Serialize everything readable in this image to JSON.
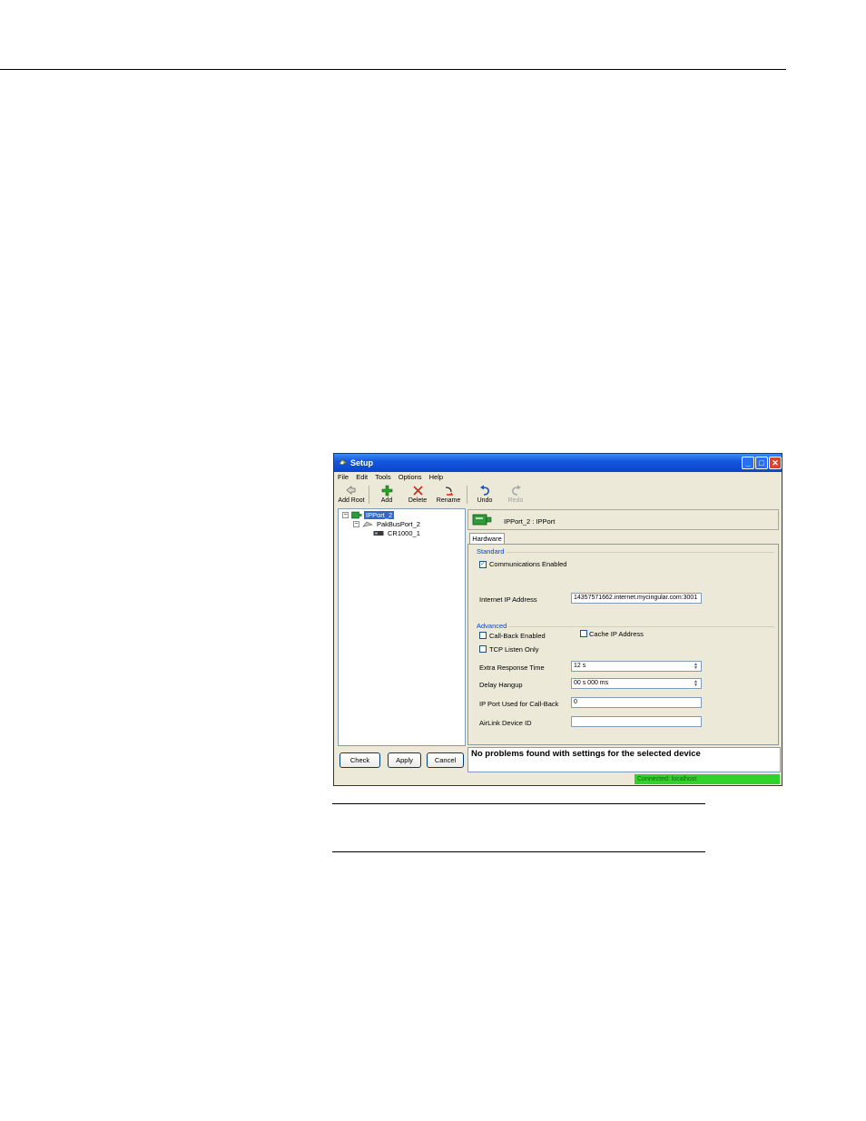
{
  "window": {
    "title": "Setup",
    "controls": {
      "minimize": "_",
      "maximize": "□",
      "close": "✕"
    }
  },
  "menu": [
    "File",
    "Edit",
    "Tools",
    "Options",
    "Help"
  ],
  "toolbar": {
    "add_root": "Add Root",
    "add": "Add",
    "delete": "Delete",
    "rename": "Rename",
    "undo": "Undo",
    "redo": "Redo"
  },
  "tree": {
    "nodes": [
      {
        "label": "IPPort_2",
        "expander": "−",
        "selected": true
      },
      {
        "label": "PakBusPort_2",
        "expander": "−"
      },
      {
        "label": "CR1000_1"
      }
    ]
  },
  "buttons": {
    "check": "Check",
    "apply": "Apply",
    "cancel": "Cancel"
  },
  "device_header": "IPPort_2 : IPPort",
  "tabs": [
    "Hardware"
  ],
  "standard": {
    "title": "Standard",
    "communications_enabled": {
      "label": "Communications Enabled",
      "checked": true,
      "mark": "✓"
    },
    "internet_ip_address": {
      "label": "Internet IP Address",
      "value": "14357571662.internet.mycingular.com:3001"
    }
  },
  "advanced": {
    "title": "Advanced",
    "call_back_enabled": {
      "label": "Call-Back Enabled",
      "checked": false
    },
    "cache_ip_address": {
      "label": "Cache IP Address",
      "checked": false
    },
    "tcp_listen_only": {
      "label": "TCP Listen Only",
      "checked": false
    },
    "extra_response_time": {
      "label": "Extra Response Time",
      "value": "12 s"
    },
    "delay_hangup": {
      "label": "Delay Hangup",
      "value": "00 s 000 ms"
    },
    "ip_port_callback": {
      "label": "IP Port Used for Call-Back",
      "value": "0"
    },
    "airlink_device_id": {
      "label": "AirLink Device ID",
      "value": ""
    }
  },
  "spinner": {
    "up": "▲",
    "down": "▼"
  },
  "message": "No problems found with settings for the selected device",
  "status": "Connected: localhost",
  "colors": {
    "titlebar": "#0a45c8",
    "selection": "#316ac5",
    "group_title": "#0046d5",
    "status_ok": "#31d22b"
  }
}
